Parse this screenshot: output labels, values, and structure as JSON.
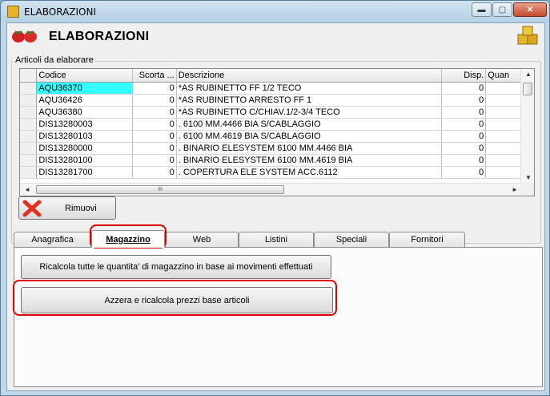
{
  "window": {
    "title": "ELABORAZIONI",
    "minimize": "▬",
    "maximize": "▢",
    "close": "✕"
  },
  "header": {
    "title": "ELABORAZIONI"
  },
  "group": {
    "label": "Articoli da elaborare"
  },
  "grid": {
    "columns": [
      "Codice",
      "Scorta ...",
      "Descrizione",
      "Disp.",
      "Quan"
    ],
    "rows": [
      [
        "AQU36370",
        "0",
        "*AS RUBINETTO        FF 1/2   TECO",
        "0",
        ""
      ],
      [
        "AQU36426",
        "0",
        "*AS RUBINETTO ARRESTO FF    1",
        "0",
        ""
      ],
      [
        "AQU36380",
        "0",
        "*AS RUBINETTO C/CHIAV.1/2-3/4  TECO",
        "0",
        ""
      ],
      [
        "DIS13280003",
        "0",
        ".  6100 MM.4466 BIA S/CABLAGGIO",
        "0",
        ""
      ],
      [
        "DIS13280103",
        "0",
        ". 6100 MM.4619 BIA S/CABLAGGIO",
        "0",
        ""
      ],
      [
        "DIS13280000",
        "0",
        ". BINARIO ELESYSTEM  6100 MM.4466 BIA",
        "0",
        ""
      ],
      [
        "DIS13280100",
        "0",
        ". BINARIO ELESYSTEM 6100 MM.4619 BIA",
        "0",
        ""
      ],
      [
        "DIS13281700",
        "0",
        ". COPERTURA ELE SYSTEM ACC.6112",
        "0",
        ""
      ]
    ],
    "selected_row": 0
  },
  "buttons": {
    "remove": "Rimuovi",
    "recalc_stock": "Ricalcola tutte le quantita' di magazzino in base ai movimenti effettuati",
    "reset_prices": "Azzera e ricalcola prezzi base articoli"
  },
  "tabs": [
    "Anagrafica",
    "Magazzino",
    "Web",
    "Listini",
    "Speciali",
    "Fornitori"
  ],
  "active_tab": "Magazzino",
  "colors": {
    "selection": "#33ffff",
    "highlight": "#e00000"
  },
  "scrollbar": {
    "v_up": "▲",
    "v_down": "▼",
    "h_left": "◄",
    "h_right": "►",
    "grip": "III"
  }
}
